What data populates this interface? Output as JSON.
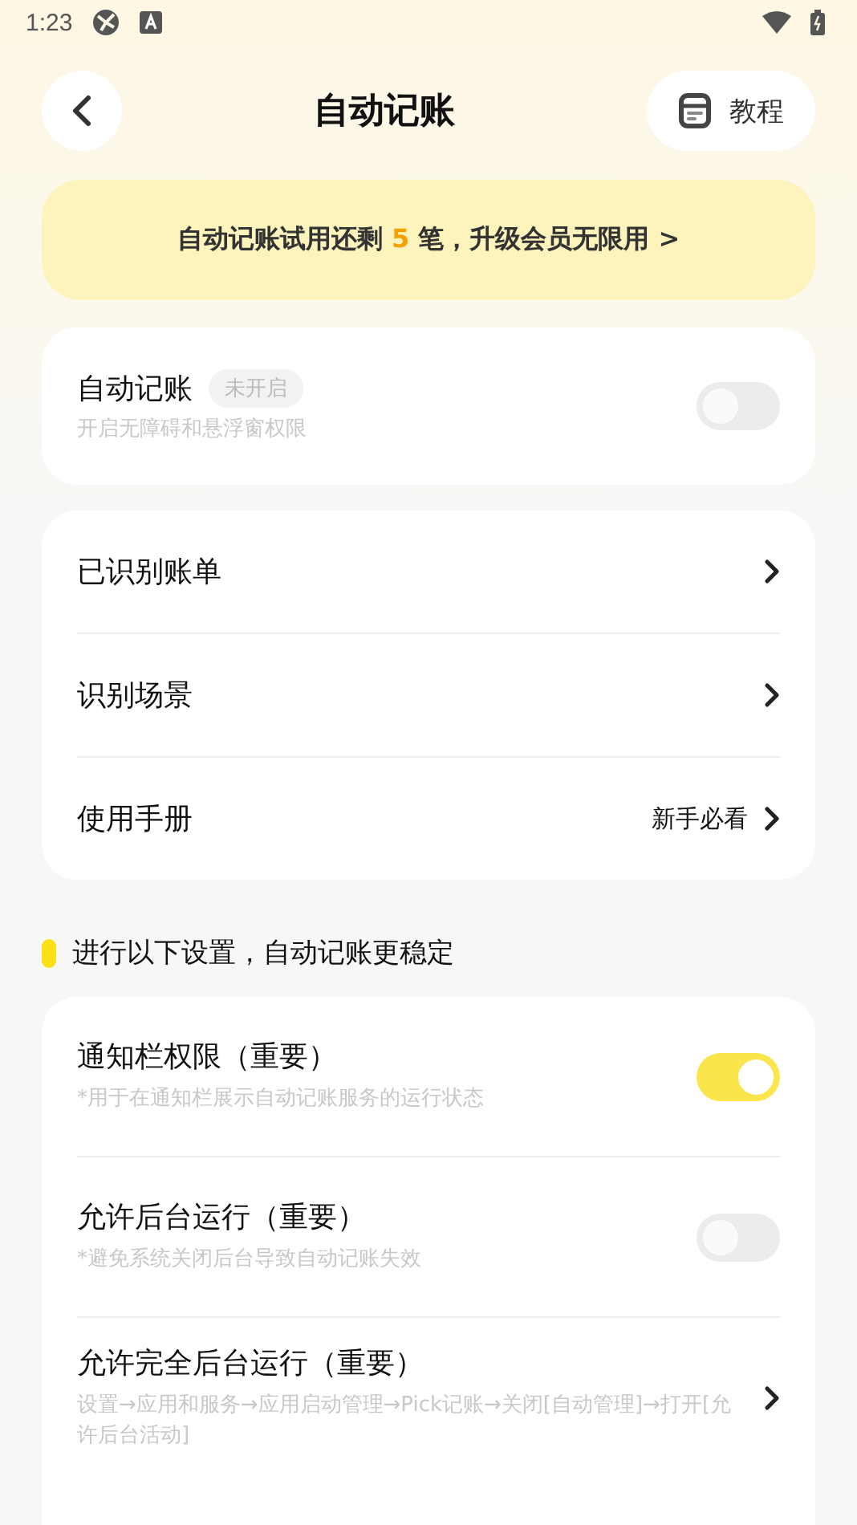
{
  "status_bar": {
    "time": "1:23"
  },
  "header": {
    "title": "自动记账",
    "tutorial_button": "教程"
  },
  "banner": {
    "prefix": "自动记账试用还剩 ",
    "count": "5",
    "suffix": " 笔，升级会员无限用 >"
  },
  "auto_card": {
    "title": "自动记账",
    "badge": "未开启",
    "subtitle": "开启无障碍和悬浮窗权限",
    "on": false
  },
  "menu": [
    {
      "label": "已识别账单"
    },
    {
      "label": "识别场景"
    },
    {
      "label": "使用手册",
      "hint": "新手必看"
    }
  ],
  "section_title": "进行以下设置，自动记账更稳定",
  "settings": [
    {
      "kind": "toggle",
      "title": "通知栏权限（重要）",
      "note": "*用于在通知栏展示自动记账服务的运行状态",
      "on": true
    },
    {
      "kind": "toggle",
      "title": "允许后台运行（重要）",
      "note": "*避免系统关闭后台导致自动记账失效",
      "on": false
    },
    {
      "kind": "link",
      "title": "允许完全后台运行（重要）",
      "note": "设置→应用和服务→应用启动管理→Pick记账→关闭[自动管理]→打开[允许后台活动]"
    }
  ]
}
